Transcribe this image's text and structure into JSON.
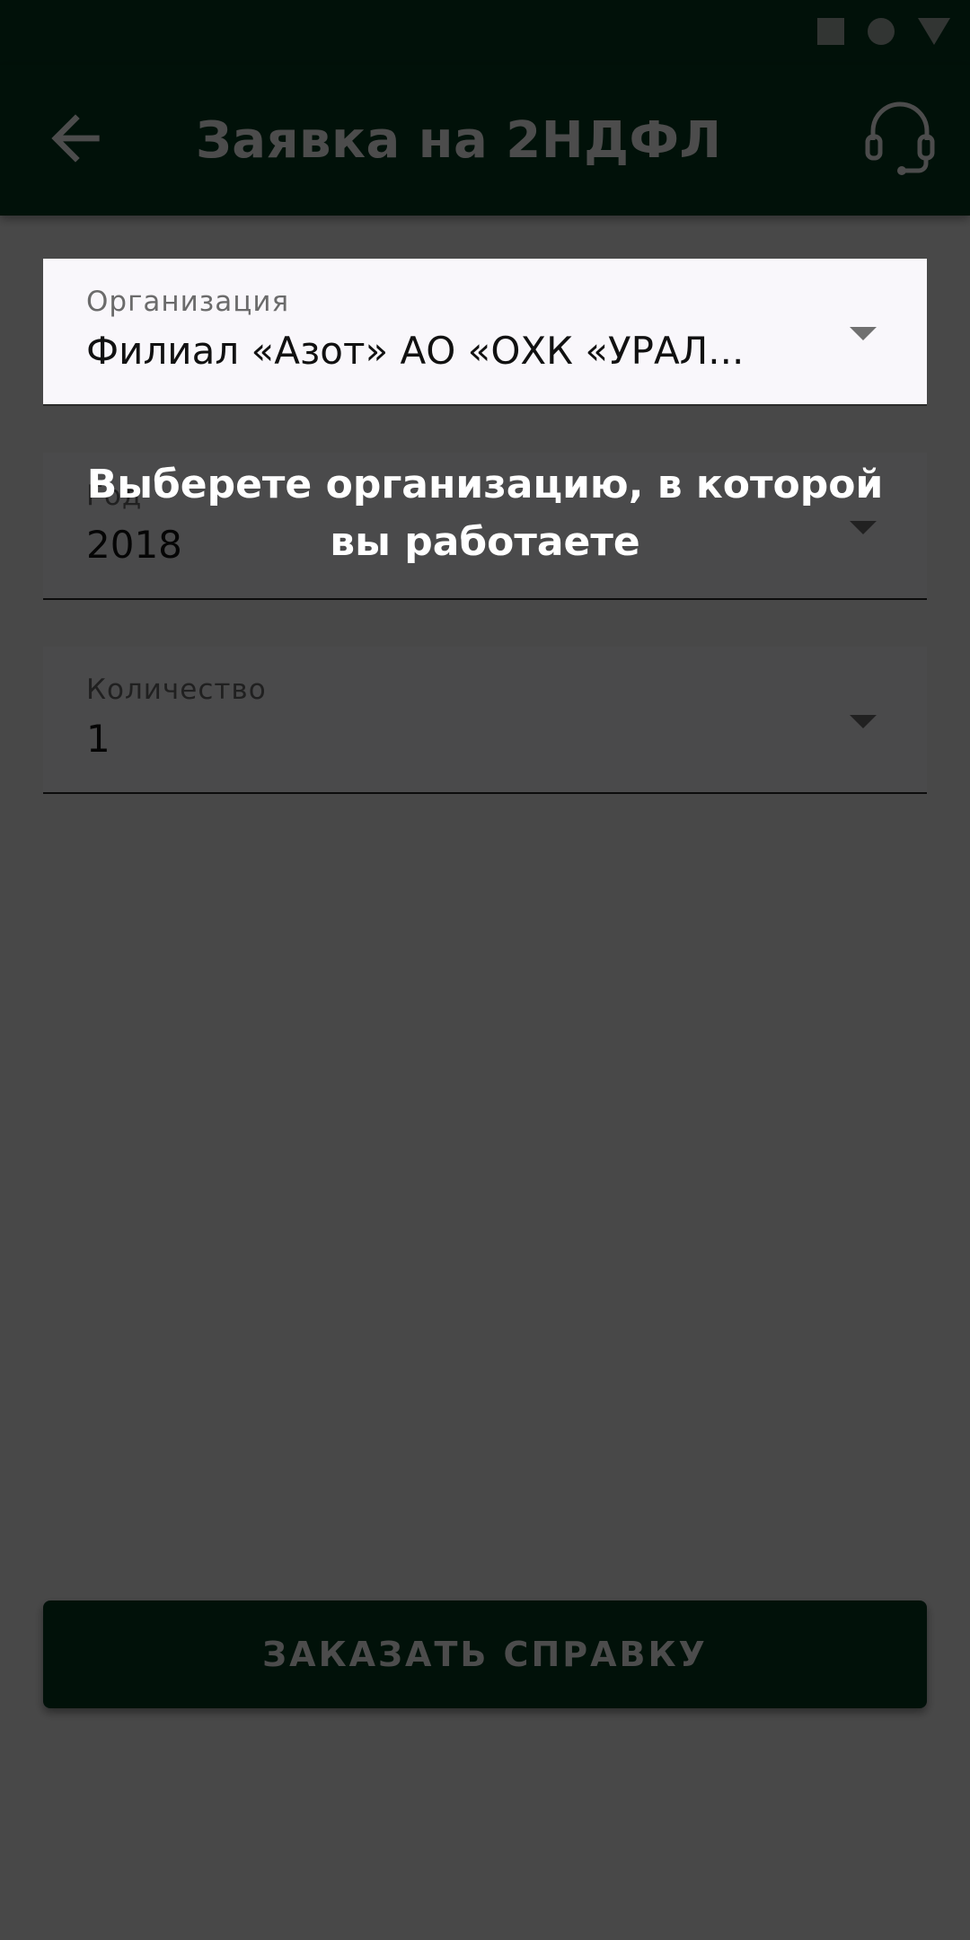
{
  "status_bar": {
    "icons": [
      "stop-square-icon",
      "record-circle-icon",
      "signal-triangle-icon"
    ]
  },
  "app_bar": {
    "title": "Заявка на 2НДФЛ",
    "back_icon": "arrow-back-icon",
    "support_icon": "headset-icon"
  },
  "form": {
    "organization": {
      "label": "Организация",
      "value": "Филиал «Азот» АО «ОХК «УРАЛ..."
    },
    "year": {
      "label": "Год",
      "value": "2018"
    },
    "quantity": {
      "label": "Количество",
      "value": "1"
    }
  },
  "order_button": {
    "label": "ЗАКАЗАТЬ СПРАВКУ"
  },
  "onboarding": {
    "hint": "Выберете организацию, в которой вы работаете"
  },
  "colors": {
    "primary": "#063a1f",
    "field_background": "#f9f7fb",
    "label": "#6b6b6b",
    "overlay": "rgba(0,0,0,0.70)"
  }
}
